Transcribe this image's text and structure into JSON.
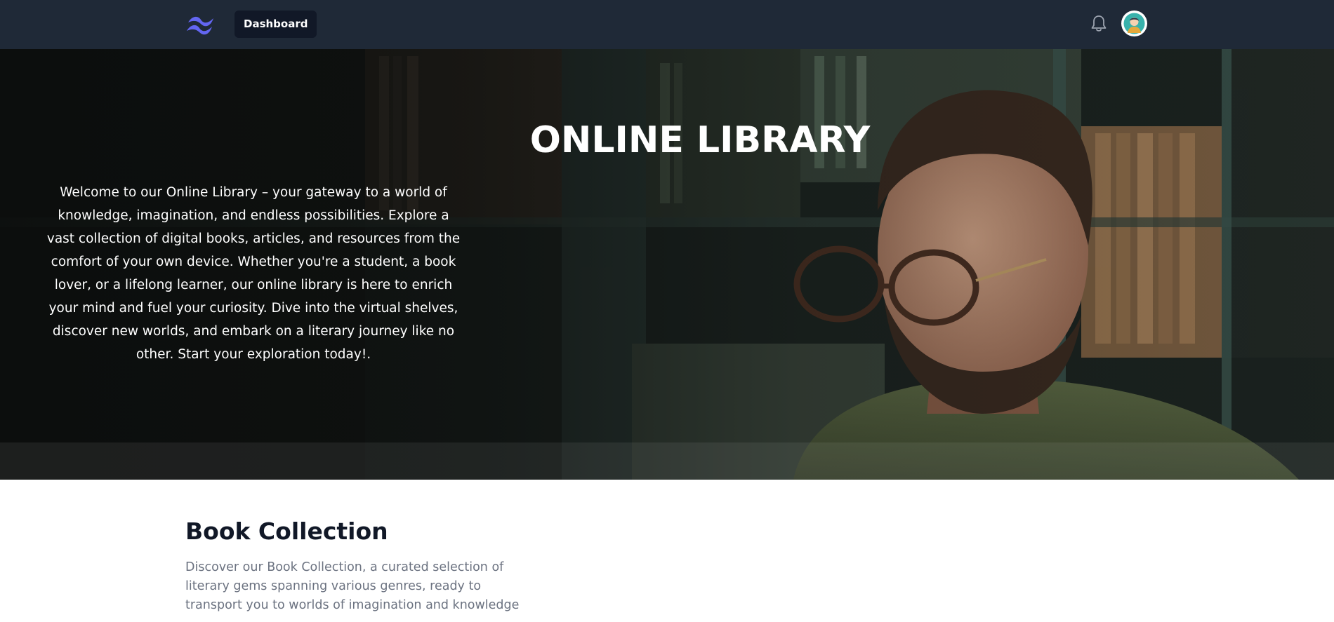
{
  "nav": {
    "logo_icon": "tailwind-wave-logo",
    "dashboard_label": "Dashboard",
    "notification_icon": "bell-icon",
    "avatar_icon": "user-avatar"
  },
  "hero": {
    "title": "ONLINE LIBRARY",
    "description": "Welcome to our Online Library – your gateway to a world of knowledge, imagination, and endless possibilities. Explore a vast collection of digital books, articles, and resources from the comfort of your own device. Whether you're a student, a book lover, or a lifelong learner, our online library is here to enrich your mind and fuel your curiosity. Dive into the virtual shelves, discover new worlds, and embark on a literary journey like no other. Start your exploration today!."
  },
  "collection": {
    "title": "Book Collection",
    "description": "Discover our Book Collection, a curated selection of literary gems spanning various genres, ready to transport you to worlds of imagination and knowledge"
  },
  "colors": {
    "navbar": "#1f2937",
    "button": "#111827",
    "logo": "#6366f1",
    "heading": "#111827",
    "muted_text": "#6b7280"
  }
}
